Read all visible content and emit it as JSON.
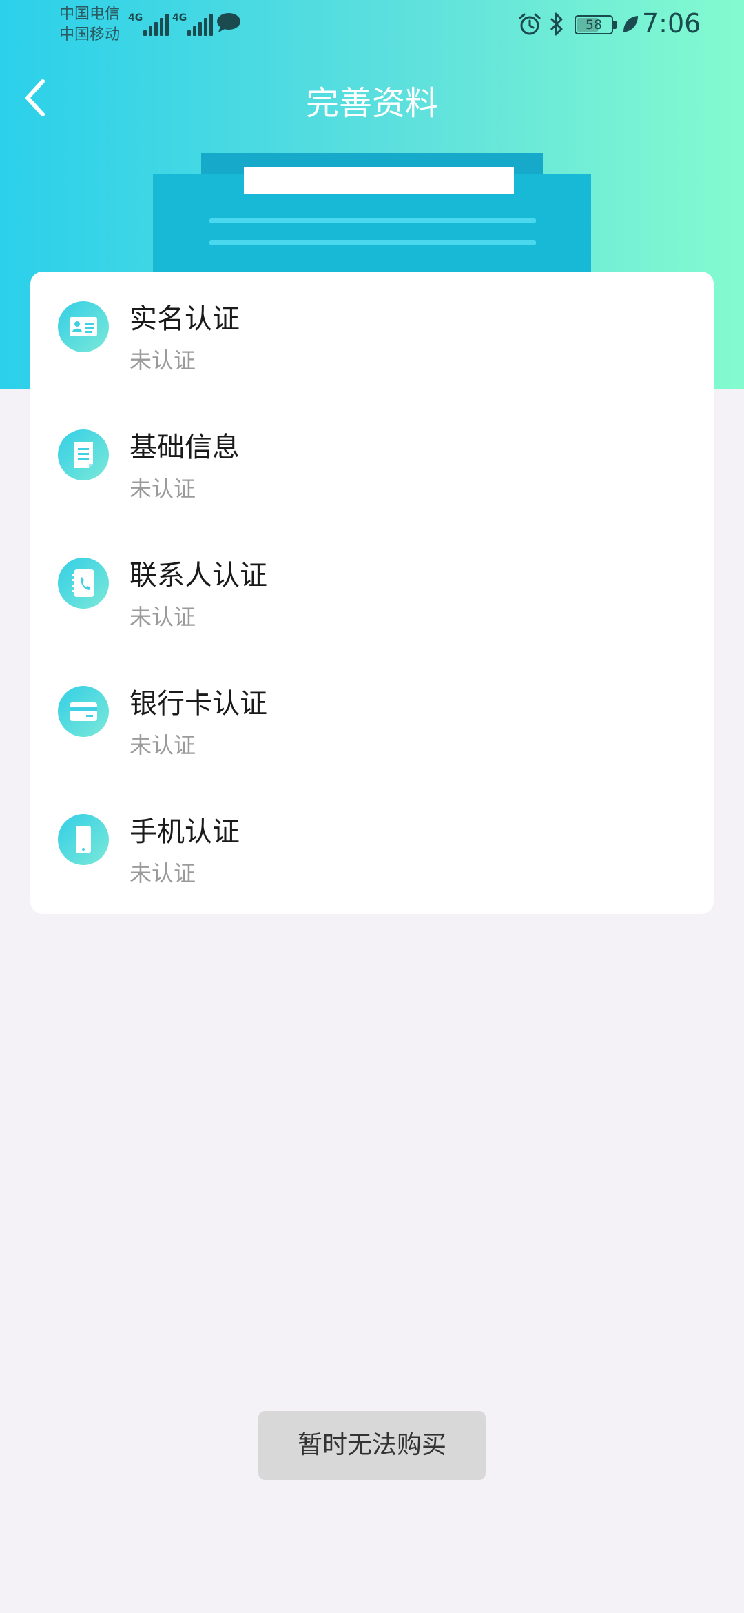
{
  "status_bar": {
    "carrier_1": "中国电信",
    "carrier_2": "中国移动",
    "network_1": "4G",
    "network_2": "4G",
    "battery": "58",
    "time": "7:06"
  },
  "header": {
    "title": "完善资料",
    "back_icon": "chevron-left-icon",
    "gradient": [
      "#2bd0ea",
      "#84fbcf"
    ]
  },
  "verification_items": [
    {
      "name": "实名认证",
      "status": "未认证",
      "icon": "id-card-icon"
    },
    {
      "name": "基础信息",
      "status": "未认证",
      "icon": "document-icon"
    },
    {
      "name": "联系人认证",
      "status": "未认证",
      "icon": "contacts-book-icon"
    },
    {
      "name": "银行卡认证",
      "status": "未认证",
      "icon": "bank-card-icon"
    },
    {
      "name": "手机认证",
      "status": "未认证",
      "icon": "mobile-phone-icon"
    }
  ],
  "footer": {
    "button_label": "暂时无法购买"
  },
  "colors": {
    "background": "#f4f1f7",
    "accent": "#2bd0ea",
    "status_text": "#9a9a9a",
    "button_bg": "#d8d8d8"
  }
}
